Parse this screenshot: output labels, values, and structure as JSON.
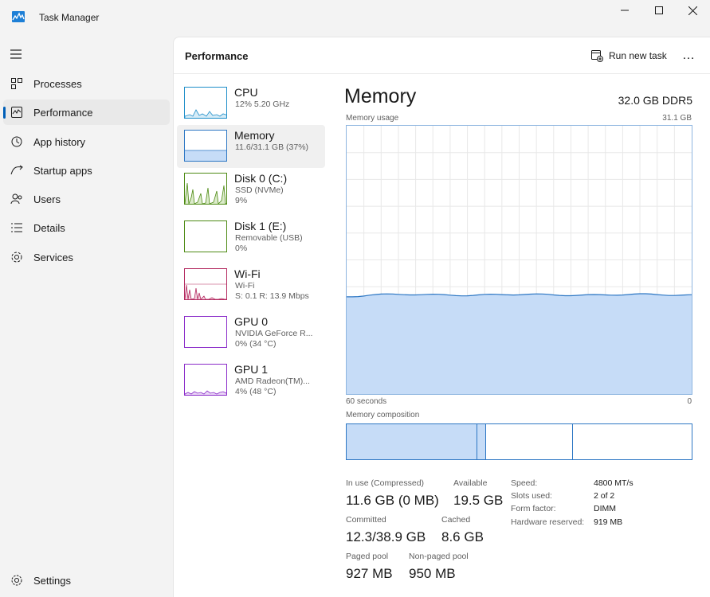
{
  "window": {
    "title": "Task Manager"
  },
  "nav": {
    "items": [
      {
        "label": "Processes",
        "icon": "processes-icon"
      },
      {
        "label": "Performance",
        "icon": "performance-icon",
        "active": true
      },
      {
        "label": "App history",
        "icon": "app-history-icon"
      },
      {
        "label": "Startup apps",
        "icon": "startup-apps-icon"
      },
      {
        "label": "Users",
        "icon": "users-icon"
      },
      {
        "label": "Details",
        "icon": "details-icon"
      },
      {
        "label": "Services",
        "icon": "services-icon"
      }
    ],
    "settings_label": "Settings"
  },
  "header": {
    "title": "Performance",
    "run_new_task": "Run new task",
    "more": "…"
  },
  "devices": [
    {
      "name": "CPU",
      "sub1": "12%  5.20 GHz",
      "sub2": ""
    },
    {
      "name": "Memory",
      "sub1": "11.6/31.1 GB (37%)",
      "sub2": ""
    },
    {
      "name": "Disk 0 (C:)",
      "sub1": "SSD (NVMe)",
      "sub2": "9%"
    },
    {
      "name": "Disk 1 (E:)",
      "sub1": "Removable (USB)",
      "sub2": "0%"
    },
    {
      "name": "Wi-Fi",
      "sub1": "Wi-Fi",
      "sub2": "S: 0.1  R: 13.9 Mbps"
    },
    {
      "name": "GPU 0",
      "sub1": "NVIDIA GeForce R...",
      "sub2": "0%  (34 °C)"
    },
    {
      "name": "GPU 1",
      "sub1": "AMD Radeon(TM)...",
      "sub2": "4%  (48 °C)"
    }
  ],
  "detail": {
    "title": "Memory",
    "spec": "32.0 GB DDR5",
    "usage_label": "Memory usage",
    "usage_max": "31.1 GB",
    "time_left": "60 seconds",
    "time_right": "0",
    "usage_fraction": 0.37,
    "composition_label": "Memory composition",
    "stats": {
      "in_use_label": "In use (Compressed)",
      "in_use_value": "11.6 GB (0 MB)",
      "available_label": "Available",
      "available_value": "19.5 GB",
      "committed_label": "Committed",
      "committed_value": "12.3/38.9 GB",
      "cached_label": "Cached",
      "cached_value": "8.6 GB",
      "paged_label": "Paged pool",
      "paged_value": "927 MB",
      "nonpaged_label": "Non-paged pool",
      "nonpaged_value": "950 MB"
    },
    "specs": [
      {
        "label": "Speed:",
        "value": "4800 MT/s"
      },
      {
        "label": "Slots used:",
        "value": "2 of 2"
      },
      {
        "label": "Form factor:",
        "value": "DIMM"
      },
      {
        "label": "Hardware reserved:",
        "value": "919 MB"
      }
    ]
  },
  "colors": {
    "memory_fill": "#c6dcf7",
    "memory_line": "#2d77c4",
    "cpu_line": "#1e8ec9",
    "disk_line": "#4d8a13",
    "wifi_line": "#b3295f",
    "gpu_line": "#8a2bc9",
    "accent": "#005fb8"
  }
}
